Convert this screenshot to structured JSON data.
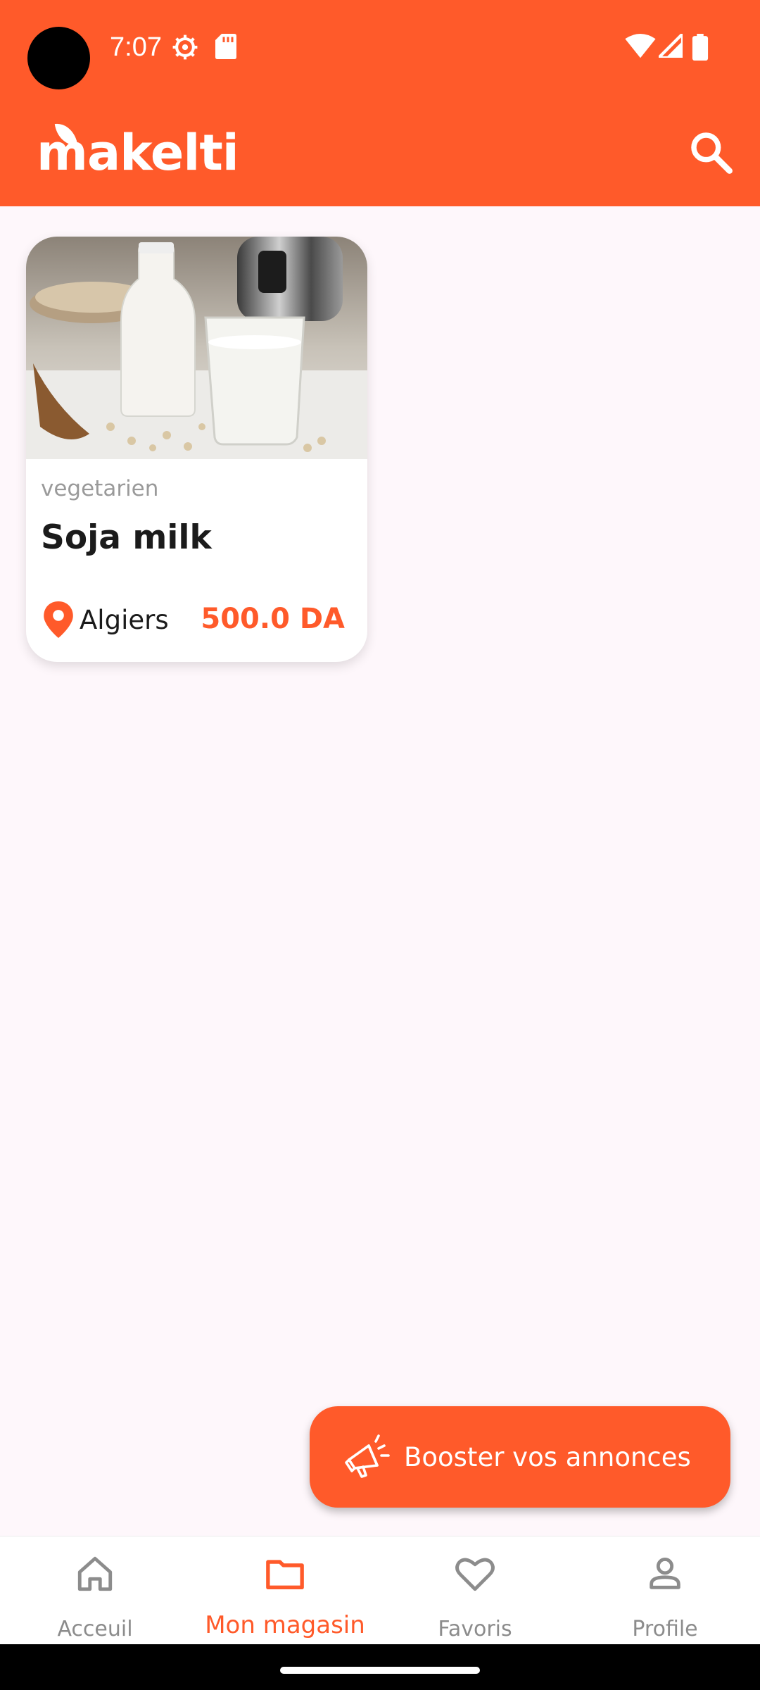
{
  "status_bar": {
    "time": "7:07",
    "icons": [
      "settings-gear-icon",
      "sd-card-icon",
      "wifi-icon",
      "cellular-signal-icon",
      "battery-icon"
    ]
  },
  "app_bar": {
    "logo_text": "makelti",
    "search_icon": "search-icon",
    "background_color": "#ff5a2a"
  },
  "listings": [
    {
      "image": "soy-milk-photo",
      "category": "vegetarien",
      "title": "Soja milk",
      "location": "Algiers",
      "location_icon": "location-pin-icon",
      "price": "500.0 DA"
    }
  ],
  "boost_button": {
    "icon": "megaphone-icon",
    "label": "Booster vos annonces"
  },
  "bottom_nav": {
    "items": [
      {
        "label": "Acceuil",
        "icon": "home-icon",
        "active": false
      },
      {
        "label": "Mon magasin",
        "icon": "folder-icon",
        "active": true
      },
      {
        "label": "Favoris",
        "icon": "heart-icon",
        "active": false
      },
      {
        "label": "Profile",
        "icon": "person-icon",
        "active": false
      }
    ]
  },
  "colors": {
    "accent": "#ff5a2a",
    "background": "#fef7fb",
    "text_primary": "#1b1b1b",
    "text_secondary": "#9a9a9a",
    "nav_inactive": "#8c8c8c"
  }
}
